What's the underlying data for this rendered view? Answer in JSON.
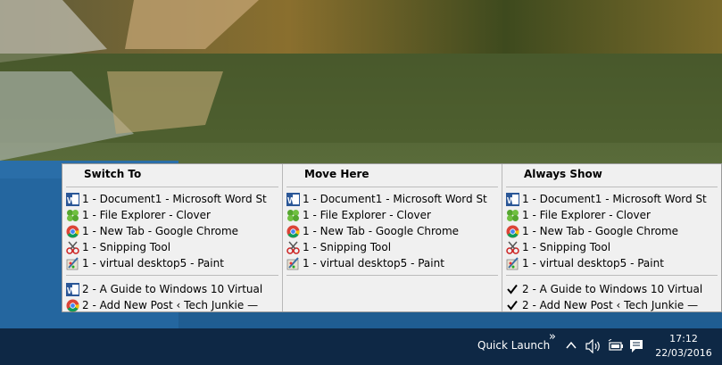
{
  "columns": [
    {
      "header": "Switch To",
      "group1": [
        {
          "label": "1 - Document1 - Microsoft Word St",
          "icon": "word-icon"
        },
        {
          "label": "1 - File Explorer - Clover",
          "icon": "clover-icon"
        },
        {
          "label": "1 - New Tab - Google Chrome",
          "icon": "chrome-icon"
        },
        {
          "label": "1 - Snipping Tool",
          "icon": "snipping-tool-icon"
        },
        {
          "label": "1 - virtual desktop5 - Paint",
          "icon": "paint-icon"
        }
      ],
      "group2": [
        {
          "label": "2 - A Guide to Windows 10 Virtual",
          "icon": "word-icon"
        },
        {
          "label": "2 - Add New Post ‹ Tech Junkie —",
          "icon": "chrome-icon"
        }
      ]
    },
    {
      "header": "Move Here",
      "group1": [
        {
          "label": "1 - Document1 - Microsoft Word St",
          "icon": "word-icon"
        },
        {
          "label": "1 - File Explorer - Clover",
          "icon": "clover-icon"
        },
        {
          "label": "1 - New Tab - Google Chrome",
          "icon": "chrome-icon"
        },
        {
          "label": "1 - Snipping Tool",
          "icon": "snipping-tool-icon"
        },
        {
          "label": "1 - virtual desktop5 - Paint",
          "icon": "paint-icon"
        }
      ],
      "group2": []
    },
    {
      "header": "Always Show",
      "group1": [
        {
          "label": "1 - Document1 - Microsoft Word St",
          "icon": "word-icon"
        },
        {
          "label": "1 - File Explorer - Clover",
          "icon": "clover-icon"
        },
        {
          "label": "1 - New Tab - Google Chrome",
          "icon": "chrome-icon"
        },
        {
          "label": "1 - Snipping Tool",
          "icon": "snipping-tool-icon"
        },
        {
          "label": "1 - virtual desktop5 - Paint",
          "icon": "paint-icon"
        }
      ],
      "group2": [
        {
          "label": "2 - A Guide to Windows 10 Virtual",
          "icon": "check-icon"
        },
        {
          "label": "2 - Add New Post ‹ Tech Junkie —",
          "icon": "check-icon"
        }
      ]
    }
  ],
  "taskbar": {
    "quick_launch_label": "Quick Launch",
    "chevron": "»",
    "time": "17:12",
    "date": "22/03/2016"
  },
  "colors": {
    "taskbar_bg": "#0e2845",
    "menu_bg": "#f0f0f0",
    "word_blue": "#2b5797",
    "chrome_red": "#db4437",
    "chrome_yellow": "#f4c20d",
    "chrome_green": "#0f9d58",
    "chrome_blue": "#4285f4"
  }
}
